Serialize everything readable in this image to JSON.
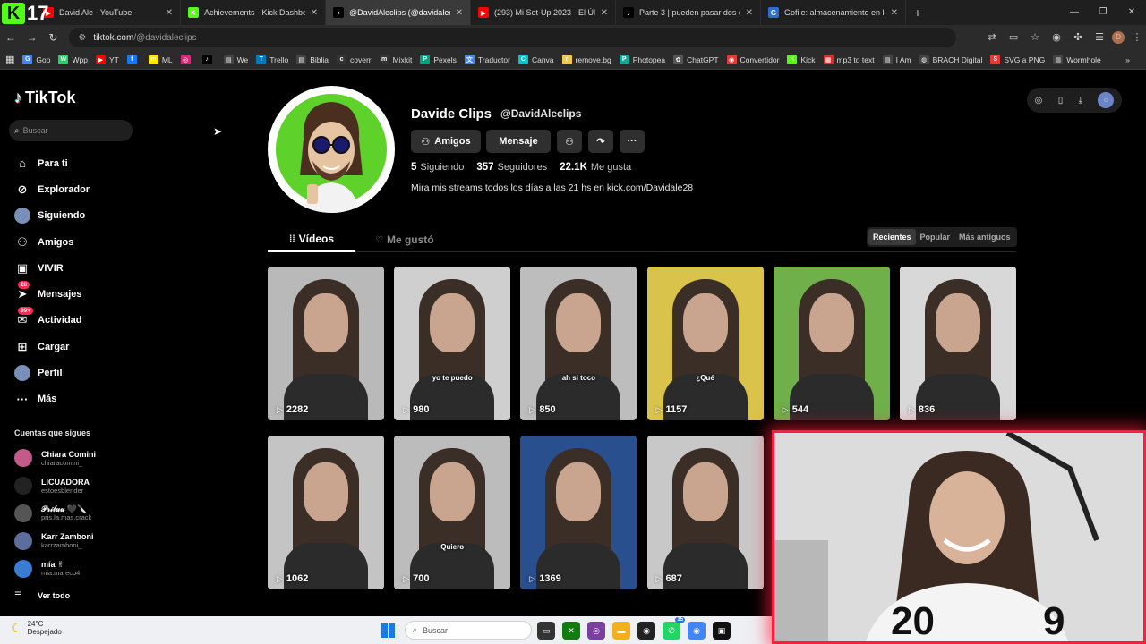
{
  "browser": {
    "tabs": [
      {
        "title": "David Ale - YouTube",
        "fav": "▶",
        "color": "#ff0000"
      },
      {
        "title": "Achievements - Kick Dashboard",
        "fav": "K",
        "color": "#53fc18"
      },
      {
        "title": "@DavidAleclips (@davidaleclips)",
        "fav": "♪",
        "color": "#000000",
        "active": true
      },
      {
        "title": "(293) Mi Set-Up 2023 - El Últim",
        "fav": "▶",
        "color": "#ff0000"
      },
      {
        "title": "Parte 3 | pueden pasar dos cosa",
        "fav": "♪",
        "color": "#000000"
      },
      {
        "title": "Gofile: almacenamiento en la n",
        "fav": "G",
        "color": "#2b6fd6"
      }
    ],
    "overlay_logo": {
      "letter": "K",
      "number": "17"
    },
    "url_host": "tiktok.com",
    "url_path": "/@davidaleclips",
    "bookmarks": [
      {
        "label": "Goo",
        "color": "#4285f4",
        "icon": "G"
      },
      {
        "label": "Wpp",
        "color": "#25d366",
        "icon": "W"
      },
      {
        "label": "YT",
        "color": "#ff0000",
        "icon": "▶"
      },
      {
        "label": "",
        "color": "#1877f2",
        "icon": "f"
      },
      {
        "label": "ML",
        "color": "#ffe600",
        "icon": "m"
      },
      {
        "label": "",
        "color": "#d62976",
        "icon": "◎"
      },
      {
        "label": "",
        "color": "#000000",
        "icon": "♪"
      },
      {
        "label": "We",
        "color": "#444444",
        "icon": "▤"
      },
      {
        "label": "Trello",
        "color": "#0079bf",
        "icon": "T"
      },
      {
        "label": "Biblia",
        "color": "#444444",
        "icon": "▤"
      },
      {
        "label": "coverr",
        "color": "#333333",
        "icon": "c"
      },
      {
        "label": "Mixkit",
        "color": "#333333",
        "icon": "m"
      },
      {
        "label": "Pexels",
        "color": "#05a081",
        "icon": "P"
      },
      {
        "label": "Traductor",
        "color": "#4285f4",
        "icon": "文"
      },
      {
        "label": "Canva",
        "color": "#00c4cc",
        "icon": "C"
      },
      {
        "label": "remove.bg",
        "color": "#f2c94c",
        "icon": "r"
      },
      {
        "label": "Photopea",
        "color": "#18a497",
        "icon": "P"
      },
      {
        "label": "ChatGPT",
        "color": "#555555",
        "icon": "✿"
      },
      {
        "label": "Convertidor",
        "color": "#e53935",
        "icon": "◉"
      },
      {
        "label": "Kick",
        "color": "#53fc18",
        "icon": "K"
      },
      {
        "label": "mp3 to text",
        "color": "#d32f2f",
        "icon": "▦"
      },
      {
        "label": "I Am",
        "color": "#444444",
        "icon": "▤"
      },
      {
        "label": "BRACH Digital",
        "color": "#444444",
        "icon": "◍"
      },
      {
        "label": "SVG a PNG",
        "color": "#e53935",
        "icon": "S"
      },
      {
        "label": "Wormhole",
        "color": "#444444",
        "icon": "▤"
      }
    ]
  },
  "tiktok": {
    "logo_text": "TikTok",
    "search_placeholder": "Buscar",
    "menu": [
      {
        "label": "Para ti",
        "icon": "⌂",
        "name": "home-icon"
      },
      {
        "label": "Explorador",
        "icon": "⊘",
        "name": "compass-icon"
      },
      {
        "label": "Siguiendo",
        "icon": "",
        "name": "following-avatar-icon",
        "avatar": true
      },
      {
        "label": "Amigos",
        "icon": "⚇",
        "name": "friends-icon"
      },
      {
        "label": "VIVIR",
        "icon": "▣",
        "name": "live-icon"
      },
      {
        "label": "Mensajes",
        "icon": "➤",
        "name": "messages-icon",
        "badge": "28"
      },
      {
        "label": "Actividad",
        "icon": "✉",
        "name": "activity-icon",
        "badge": "99+"
      },
      {
        "label": "Cargar",
        "icon": "⊞",
        "name": "upload-icon"
      },
      {
        "label": "Perfil",
        "icon": "",
        "name": "profile-avatar-icon",
        "avatar": true
      },
      {
        "label": "Más",
        "icon": "···",
        "name": "more-icon"
      }
    ],
    "following_title": "Cuentas que sigues",
    "following": [
      {
        "name": "Chiara Comini",
        "handle": "chiaracomini_",
        "color": "#c45a8a"
      },
      {
        "name": "LICUADORA",
        "handle": "estoesblender",
        "color": "#222222"
      },
      {
        "name": "𝒫𝓇𝒾𝓁𝓊𝓊 🖤🔪",
        "handle": "pris.la.mas.crack",
        "color": "#555555"
      },
      {
        "name": "Karr Zamboni",
        "handle": "karrzamboni_",
        "color": "#5b6e9c"
      },
      {
        "name": "mía ✌",
        "handle": "mia.mareco4",
        "color": "#3a7bd5"
      }
    ],
    "see_all": "Ver todo"
  },
  "profile": {
    "name": "Davide Clips",
    "handle": "@DavidAleclips",
    "btn_friends": "Amigos",
    "btn_message": "Mensaje",
    "following_count": "5",
    "following_label": "Siguiendo",
    "followers_count": "357",
    "followers_label": "Seguidores",
    "likes_count": "22.1K",
    "likes_label": "Me gusta",
    "bio": "Mira mis streams todos los días a las 21 hs en kick.com/Davidale28",
    "tab_videos": "Vídeos",
    "tab_liked": "Me gustó",
    "sort": [
      "Recientes",
      "Popular",
      "Más antiguos"
    ]
  },
  "videos": [
    {
      "views": "2282",
      "caption": ""
    },
    {
      "views": "980",
      "caption": "yo te puedo"
    },
    {
      "views": "850",
      "caption": "ah si toco"
    },
    {
      "views": "1157",
      "caption": "¿Qué"
    },
    {
      "views": "544",
      "caption": ""
    },
    {
      "views": "836",
      "caption": ""
    },
    {
      "views": "1062",
      "caption": ""
    },
    {
      "views": "700",
      "caption": "Quiero"
    },
    {
      "views": "1369",
      "caption": ""
    },
    {
      "views": "687",
      "caption": ""
    }
  ],
  "taskbar": {
    "temp": "24°C",
    "weather": "Despejado",
    "search": "Buscar",
    "badge": "35"
  }
}
